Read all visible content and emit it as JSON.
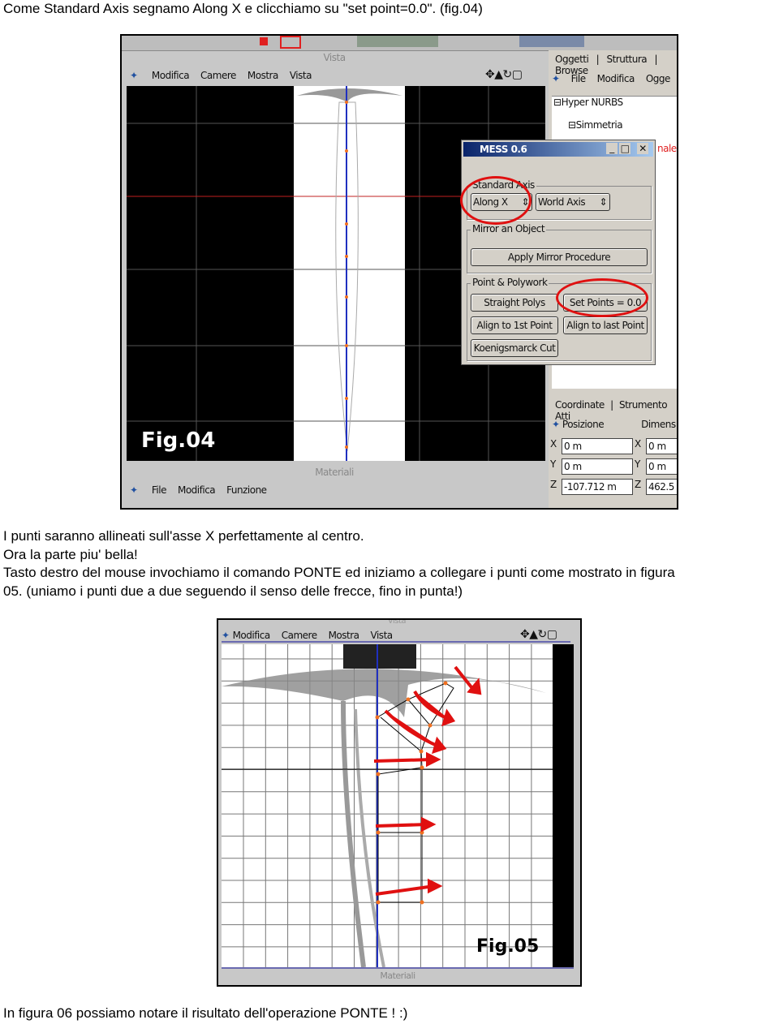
{
  "paragraphs": {
    "p1": "Come Standard Axis segnamo Along X e clicchiamo su \"set point=0.0\". (fig.04)",
    "p2": "I punti saranno allineati sull'asse X perfettamente al centro.",
    "p3": "Ora la parte piu' bella!",
    "p4": "Tasto destro del mouse invochiamo il comando PONTE ed iniziamo a collegare i punti come mostrato in figura",
    "p5": "05. (uniamo i punti due a due seguendo il senso delle frecce, fino in punta!)",
    "p6": "In figura 06 possiamo notare il risultato dell'operazione PONTE ! :)"
  },
  "fig04": {
    "label": "Fig.04",
    "viewport_title": "Vista",
    "viewport_menu": [
      "Modifica",
      "Camere",
      "Mostra",
      "Vista"
    ],
    "materials_title": "Materiali",
    "materials_menu": [
      "File",
      "Modifica",
      "Funzione"
    ],
    "objects_tabs": [
      "Oggetti",
      "Struttura",
      "Browse"
    ],
    "objects_menu": [
      "File",
      "Modifica",
      "Ogge"
    ],
    "tree": [
      "Hyper NURBS",
      "Simmetria"
    ],
    "partial_text": "nale",
    "coords_tabs": [
      "Coordinate",
      "Strumento Atti"
    ],
    "coords_headers": [
      "Posizione",
      "Dimens"
    ],
    "coords": [
      {
        "axis": "X",
        "pos": "0 m",
        "dim": "0 m"
      },
      {
        "axis": "Y",
        "pos": "0 m",
        "dim": "0 m"
      },
      {
        "axis": "Z",
        "pos": "-107.712 m",
        "dim": "462.5"
      }
    ],
    "dialog": {
      "title": "MESS 0.6",
      "standard_axis_label": "Standard Axis",
      "axis_select": "Along X",
      "world_select": "World Axis",
      "mirror_label": "Mirror an Object",
      "apply_mirror": "Apply Mirror Procedure",
      "point_label": "Point & Polywork",
      "straight_polys": "Straight Polys",
      "set_points": "Set Points = 0.0",
      "align_first": "Align to 1st Point",
      "align_last": "Align to last Point",
      "koenigsmarck": "Koenigsmarck Cut"
    },
    "highlight_color": "#e01010"
  },
  "fig05": {
    "label": "Fig.05",
    "viewport_title": "Vista",
    "viewport_menu": [
      "Modifica",
      "Camere",
      "Mostra",
      "Vista"
    ],
    "materials_title": "Materiali",
    "arrow_color": "#e01010"
  }
}
